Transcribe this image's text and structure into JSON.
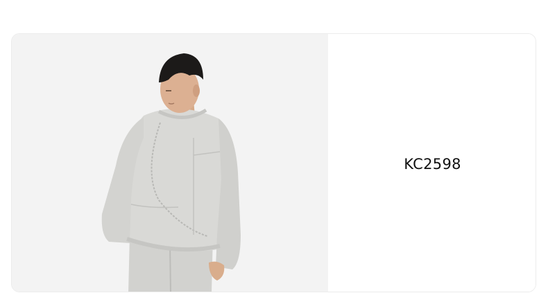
{
  "product": {
    "sku": "KC2598",
    "image": {
      "subject": "model-wearing-light-grey-knit-sweater",
      "colors": {
        "background": "#f3f3f3",
        "sweater": "#d9d9d6",
        "sweater_shadow": "#c3c3c0",
        "hair": "#1c1a19",
        "skin": "#d9ad8c"
      }
    }
  }
}
